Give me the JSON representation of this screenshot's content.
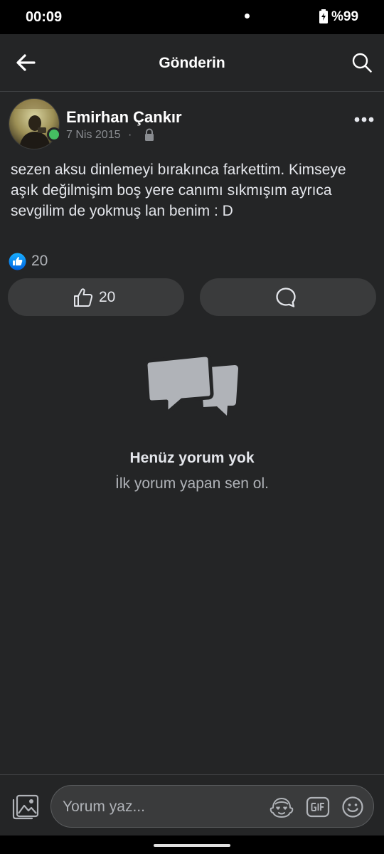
{
  "status_bar": {
    "time": "00:09",
    "battery": "%99"
  },
  "header": {
    "title": "Gönderin"
  },
  "post": {
    "author": "Emirhan Çankır",
    "date": "7 Nis 2015",
    "meta_separator": "·",
    "text": "sezen aksu dinlemeyi bırakınca farkettim. Kimseye aşık değilmişim boş yere canımı sıkmışım ayrıca sevgilim de yokmuş lan benim : D",
    "reaction_count": "20",
    "like_count": "20"
  },
  "empty_state": {
    "title": "Henüz yorum yok",
    "subtitle": "İlk yorum yapan sen ol."
  },
  "composer": {
    "placeholder": "Yorum yaz..."
  },
  "colors": {
    "background": "#242526",
    "button_bg": "#3a3b3c",
    "online": "#45bd62",
    "like_blue": "#1877f2"
  },
  "icons": [
    "battery-charging-icon",
    "back-arrow-icon",
    "search-icon",
    "lock-icon",
    "more-options-icon",
    "like-reaction-icon",
    "thumbs-up-icon",
    "comment-icon",
    "comments-empty-icon",
    "photo-icon",
    "avatar-sticker-icon",
    "gif-icon",
    "emoji-icon"
  ]
}
